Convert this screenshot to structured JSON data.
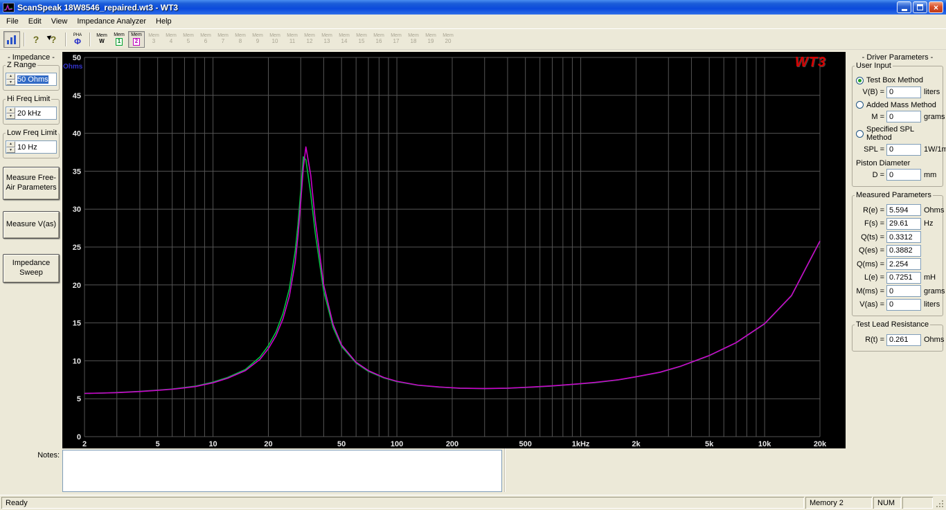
{
  "window": {
    "title": "ScanSpeak 18W8546_repaired.wt3 - WT3"
  },
  "menu": {
    "items": [
      "File",
      "Edit",
      "View",
      "Impedance Analyzer",
      "Help"
    ]
  },
  "toolbar": {
    "pha_label": "PHA",
    "pha_glyph": "Φ",
    "mem_buttons": [
      {
        "top": "Mem",
        "bottom": "W",
        "state": "normal",
        "accent": "mem-w"
      },
      {
        "top": "Mem",
        "bottom": "1",
        "state": "normal",
        "accent": "mem-1"
      },
      {
        "top": "Mem",
        "bottom": "2",
        "state": "pressed",
        "accent": "mem-2"
      },
      {
        "top": "Mem",
        "bottom": "3",
        "state": "disabled"
      },
      {
        "top": "Mem",
        "bottom": "4",
        "state": "disabled"
      },
      {
        "top": "Mem",
        "bottom": "5",
        "state": "disabled"
      },
      {
        "top": "Mem",
        "bottom": "6",
        "state": "disabled"
      },
      {
        "top": "Mem",
        "bottom": "7",
        "state": "disabled"
      },
      {
        "top": "Mem",
        "bottom": "8",
        "state": "disabled"
      },
      {
        "top": "Mem",
        "bottom": "9",
        "state": "disabled"
      },
      {
        "top": "Mem",
        "bottom": "10",
        "state": "disabled"
      },
      {
        "top": "Mem",
        "bottom": "11",
        "state": "disabled"
      },
      {
        "top": "Mem",
        "bottom": "12",
        "state": "disabled"
      },
      {
        "top": "Mem",
        "bottom": "13",
        "state": "disabled"
      },
      {
        "top": "Mem",
        "bottom": "14",
        "state": "disabled"
      },
      {
        "top": "Mem",
        "bottom": "15",
        "state": "disabled"
      },
      {
        "top": "Mem",
        "bottom": "16",
        "state": "disabled"
      },
      {
        "top": "Mem",
        "bottom": "17",
        "state": "disabled"
      },
      {
        "top": "Mem",
        "bottom": "18",
        "state": "disabled"
      },
      {
        "top": "Mem",
        "bottom": "19",
        "state": "disabled"
      },
      {
        "top": "Mem",
        "bottom": "20",
        "state": "disabled"
      }
    ]
  },
  "impedance_panel": {
    "title": "- Impedance -",
    "z_range_label": "Z Range",
    "z_range_value": "50 Ohms",
    "hi_freq_label": "Hi Freq Limit",
    "hi_freq_value": "20 kHz",
    "low_freq_label": "Low Freq Limit",
    "low_freq_value": "10 Hz",
    "buttons": [
      "Measure Free-Air Parameters",
      "Measure V(as)",
      "Impedance Sweep"
    ]
  },
  "driver_panel": {
    "title": "- Driver Parameters -",
    "user_input": {
      "title": "User Input",
      "methods": [
        {
          "label": "Test Box Method",
          "selected": true,
          "field": "V(B) =",
          "value": "0",
          "unit": "liters"
        },
        {
          "label": "Added Mass Method",
          "selected": false,
          "field": "M =",
          "value": "0",
          "unit": "grams"
        },
        {
          "label": "Specified SPL Method",
          "selected": false,
          "field": "SPL =",
          "value": "0",
          "unit": "1W/1m"
        }
      ],
      "piston_label": "Piston Diameter",
      "piston": {
        "field": "D =",
        "value": "0",
        "unit": "mm"
      }
    },
    "measured": {
      "title": "Measured Parameters",
      "rows": [
        {
          "field": "R(e) =",
          "value": "5.594",
          "unit": "Ohms"
        },
        {
          "field": "F(s) =",
          "value": "29.61",
          "unit": "Hz"
        },
        {
          "field": "Q(ts) =",
          "value": "0.3312",
          "unit": ""
        },
        {
          "field": "Q(es) =",
          "value": "0.3882",
          "unit": ""
        },
        {
          "field": "Q(ms) =",
          "value": "2.254",
          "unit": ""
        },
        {
          "field": "L(e) =",
          "value": "0.7251",
          "unit": "mH"
        },
        {
          "field": "M(ms) =",
          "value": "0",
          "unit": "grams"
        },
        {
          "field": "V(as) =",
          "value": "0",
          "unit": "liters"
        }
      ]
    },
    "test_lead": {
      "title": "Test Lead Resistance",
      "row": {
        "field": "R(t) =",
        "value": "0.261",
        "unit": "Ohms"
      }
    }
  },
  "notes": {
    "label": "Notes:",
    "value": ""
  },
  "statusbar": {
    "ready": "Ready",
    "memory": "Memory 2",
    "num": "NUM"
  },
  "chart_data": {
    "type": "line",
    "title": "",
    "ylabel": "Ohms",
    "x_scale": "log",
    "xlim": [
      2,
      20000
    ],
    "ylim": [
      0,
      50
    ],
    "y_tick_step": 5,
    "x_tick_values": [
      2,
      5,
      10,
      20,
      50,
      100,
      200,
      500,
      1000,
      2000,
      5000,
      10000,
      20000
    ],
    "x_tick_labels": [
      "2",
      "5",
      "10",
      "20",
      "50",
      "100",
      "200",
      "500",
      "1kHz",
      "2k",
      "5k",
      "10k",
      "20k"
    ],
    "grid": true,
    "grid_color": "#555555",
    "tick_color": "#e8e8e8",
    "ylabel_color": "#3535cc",
    "background": "#000000",
    "logo": "WT3",
    "logo_color": "#d50000",
    "legend_position": "none",
    "x": [
      2,
      2.5,
      3,
      4,
      5,
      6,
      8,
      10,
      12,
      15,
      18,
      20,
      22,
      24,
      26,
      28,
      29,
      30,
      31,
      32,
      34,
      36,
      40,
      45,
      50,
      60,
      70,
      85,
      100,
      130,
      170,
      220,
      300,
      400,
      550,
      700,
      900,
      1200,
      1600,
      2000,
      2700,
      3500,
      5000,
      7000,
      10000,
      14000,
      20000
    ],
    "series": [
      {
        "name": "Memory 1",
        "color": "#00C040",
        "y": [
          5.7,
          5.75,
          5.82,
          5.97,
          6.13,
          6.28,
          6.65,
          7.2,
          7.8,
          8.85,
          10.5,
          12.0,
          13.8,
          16.2,
          19.5,
          24.5,
          28.0,
          32.5,
          36.9,
          36.5,
          32.0,
          26.8,
          19.2,
          14.4,
          11.9,
          9.7,
          8.6,
          7.75,
          7.25,
          6.78,
          6.53,
          6.38,
          6.33,
          6.38,
          6.53,
          6.68,
          6.88,
          7.13,
          7.48,
          7.88,
          8.48,
          9.28,
          10.68,
          12.38,
          14.88,
          18.58,
          25.78
        ]
      },
      {
        "name": "Memory 2",
        "color": "#CC00CC",
        "y": [
          5.7,
          5.75,
          5.8,
          5.95,
          6.1,
          6.25,
          6.6,
          7.1,
          7.7,
          8.7,
          10.2,
          11.6,
          13.3,
          15.5,
          18.5,
          23.0,
          26.5,
          31.0,
          35.5,
          38.2,
          34.5,
          28.5,
          20.0,
          14.8,
          12.1,
          9.8,
          8.7,
          7.8,
          7.3,
          6.8,
          6.55,
          6.4,
          6.35,
          6.4,
          6.55,
          6.7,
          6.9,
          7.15,
          7.5,
          7.9,
          8.5,
          9.3,
          10.7,
          12.4,
          14.9,
          18.6,
          25.8
        ]
      }
    ]
  }
}
